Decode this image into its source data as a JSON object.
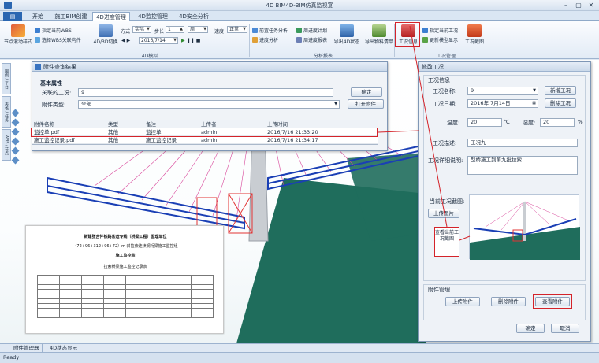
{
  "titlebar": {
    "title": "4D BIM4D-BIM仿真监视宴"
  },
  "tabs": [
    {
      "label": "开始"
    },
    {
      "label": "施工BIM创建"
    },
    {
      "label": "4D进度管理"
    },
    {
      "label": "4D监控管理"
    },
    {
      "label": "4D安全分析"
    }
  ],
  "ribbon": {
    "node_style": "节点滚动样式",
    "assign_wbs": "指定当前WBS",
    "select_wbs": "选择WBS关联构件",
    "switch_4d3d": "4D/3D切换",
    "mode_label": "方式",
    "mode_value": "实际",
    "step_label": "步长",
    "step_value": "1",
    "step_unit": "周",
    "date_value": "2016/7/14",
    "speed_label": "速度",
    "speed_value": "正常",
    "playback_group": "4D模拟",
    "task_analysis": "前置任务分析",
    "progress_analysis": "进度分析",
    "week_plan": "周进度计划",
    "week_report": "周进度报表",
    "export_4d": "导出4D状态",
    "export_list": "导出物料清单",
    "analysis_group": "分析报表",
    "condition_info": "工况信息",
    "assign_condition": "指定当前工况",
    "update_model": "更新模型显示",
    "condition_chart": "工况截图",
    "condition_group": "工况管理"
  },
  "left_tabs": [
    "图例 / 平台",
    "表格 / 任务",
    "WBS / 节点"
  ],
  "attach_dialog": {
    "title": "附件查询结果",
    "section": "基本属性",
    "condition_label": "关联的工况:",
    "condition_value": "9",
    "type_label": "附件类型:",
    "type_value": "全部",
    "ok": "确定",
    "open": "打开附件",
    "columns": [
      "附件名称",
      "类型",
      "备注",
      "上传者",
      "上传时间"
    ],
    "rows": [
      {
        "name": "监控单.pdf",
        "type": "其他",
        "note": "监控单",
        "user": "admin",
        "time": "2016/7/16 21:33:20"
      },
      {
        "name": "施工监控记录.pdf",
        "type": "其他",
        "note": "施工监控记录",
        "user": "admin",
        "time": "2016/7/16 21:34:17"
      }
    ]
  },
  "document": {
    "line1": "新建张吉怀铁路客运专线（桥梁工程）监理单位",
    "line2": "（72+96+312+96+72）m 斜拉索连续钢桁梁施工监控组",
    "line3": "施工监控表",
    "line4": "拉索桥梁施工监控记录表"
  },
  "side_panel": {
    "title": "修改工况",
    "info_section": "工况信息",
    "name_label": "工况名称:",
    "name_value": "9",
    "new_btn": "新增工况",
    "date_label": "工况日期:",
    "date_value": "2016年 7月14日",
    "delete_btn": "删除工况",
    "temp_label": "温度:",
    "temp_value": "20",
    "temp_unit": "℃",
    "humid_label": "湿度:",
    "humid_value": "20",
    "humid_unit": "%",
    "desc_label": "工况描述:",
    "desc_value": "工况九",
    "detail_label": "工况详细说明:",
    "detail_value": "型桥施工到第九批拉索",
    "screenshot_label": "当前工况截图:",
    "upload_btn": "上传图片",
    "attach_section": "附件管理",
    "upload_attach": "上传附件",
    "delete_attach": "删除附件",
    "view_attach": "查看附件",
    "ok": "确定",
    "cancel": "取消"
  },
  "callout": {
    "text": "查看当前工况截图"
  },
  "bottom_tabs": [
    "附件管理器",
    "4D状态显示"
  ],
  "status": "Ready",
  "colors": {
    "highlight": "#d4232a",
    "truss": "#1a3fb5",
    "cable": "#d8479a",
    "ground": "#1f6d5c"
  }
}
